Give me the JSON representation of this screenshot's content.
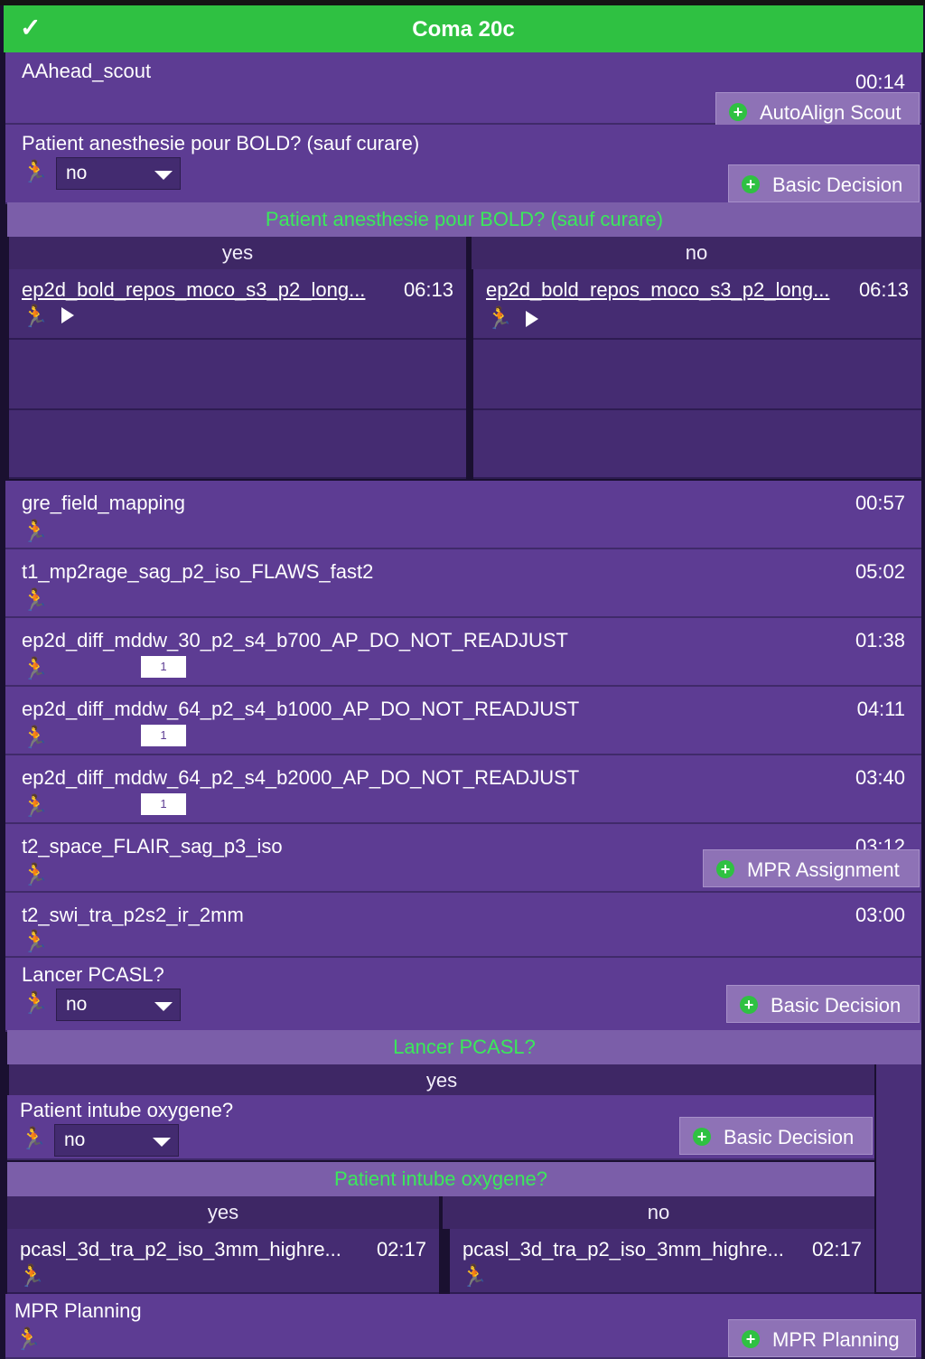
{
  "header": {
    "title": "Coma 20c",
    "check_icon": "✓"
  },
  "scout": {
    "name": "AAhead_scout",
    "time": "00:14",
    "button": "AutoAlign Scout"
  },
  "q1": {
    "question": "Patient anesthesie pour BOLD? (sauf curare)",
    "value": "no",
    "button": "Basic Decision",
    "title": "Patient anesthesie pour BOLD? (sauf curare)",
    "yes": "yes",
    "no": "no",
    "yes_item": {
      "name": "ep2d_bold_repos_moco_s3_p2_long...",
      "time": "06:13"
    },
    "no_item": {
      "name": "ep2d_bold_repos_moco_s3_p2_long...",
      "time": "06:13"
    }
  },
  "seq": [
    {
      "name": "gre_field_mapping",
      "time": "00:57"
    },
    {
      "name": "t1_mp2rage_sag_p2_iso_FLAWS_fast2",
      "time": "05:02"
    },
    {
      "name": "ep2d_diff_mddw_30_p2_s4_b700_AP_DO_NOT_READJUST",
      "time": "01:38",
      "tag": "1"
    },
    {
      "name": "ep2d_diff_mddw_64_p2_s4_b1000_AP_DO_NOT_READJUST",
      "time": "04:11",
      "tag": "1"
    },
    {
      "name": "ep2d_diff_mddw_64_p2_s4_b2000_AP_DO_NOT_READJUST",
      "time": "03:40",
      "tag": "1"
    },
    {
      "name": "t2_space_FLAIR_sag_p3_iso",
      "time": "03:12",
      "button": "MPR Assignment"
    },
    {
      "name": "t2_swi_tra_p2s2_ir_2mm",
      "time": "03:00"
    }
  ],
  "q2": {
    "question": "Lancer PCASL?",
    "value": "no",
    "button": "Basic Decision",
    "title": "Lancer PCASL?",
    "yes": "yes"
  },
  "q3": {
    "question": "Patient intube oxygene?",
    "value": "no",
    "button": "Basic Decision",
    "title": "Patient intube oxygene?",
    "yes": "yes",
    "no": "no",
    "yes_item": {
      "name": "pcasl_3d_tra_p2_iso_3mm_highre...",
      "time": "02:17"
    },
    "no_item": {
      "name": "pcasl_3d_tra_p2_iso_3mm_highre...",
      "time": "02:17"
    }
  },
  "mpr": {
    "name": "MPR Planning",
    "button": "MPR Planning"
  },
  "icons": {
    "person": "person-walking-icon",
    "plus": "plus-circle-icon",
    "play": "play-icon",
    "dropdown": "chevron-down-icon"
  },
  "colors": {
    "green": "#2fc142",
    "purple": "#5d3c93",
    "dark": "#452c72"
  }
}
